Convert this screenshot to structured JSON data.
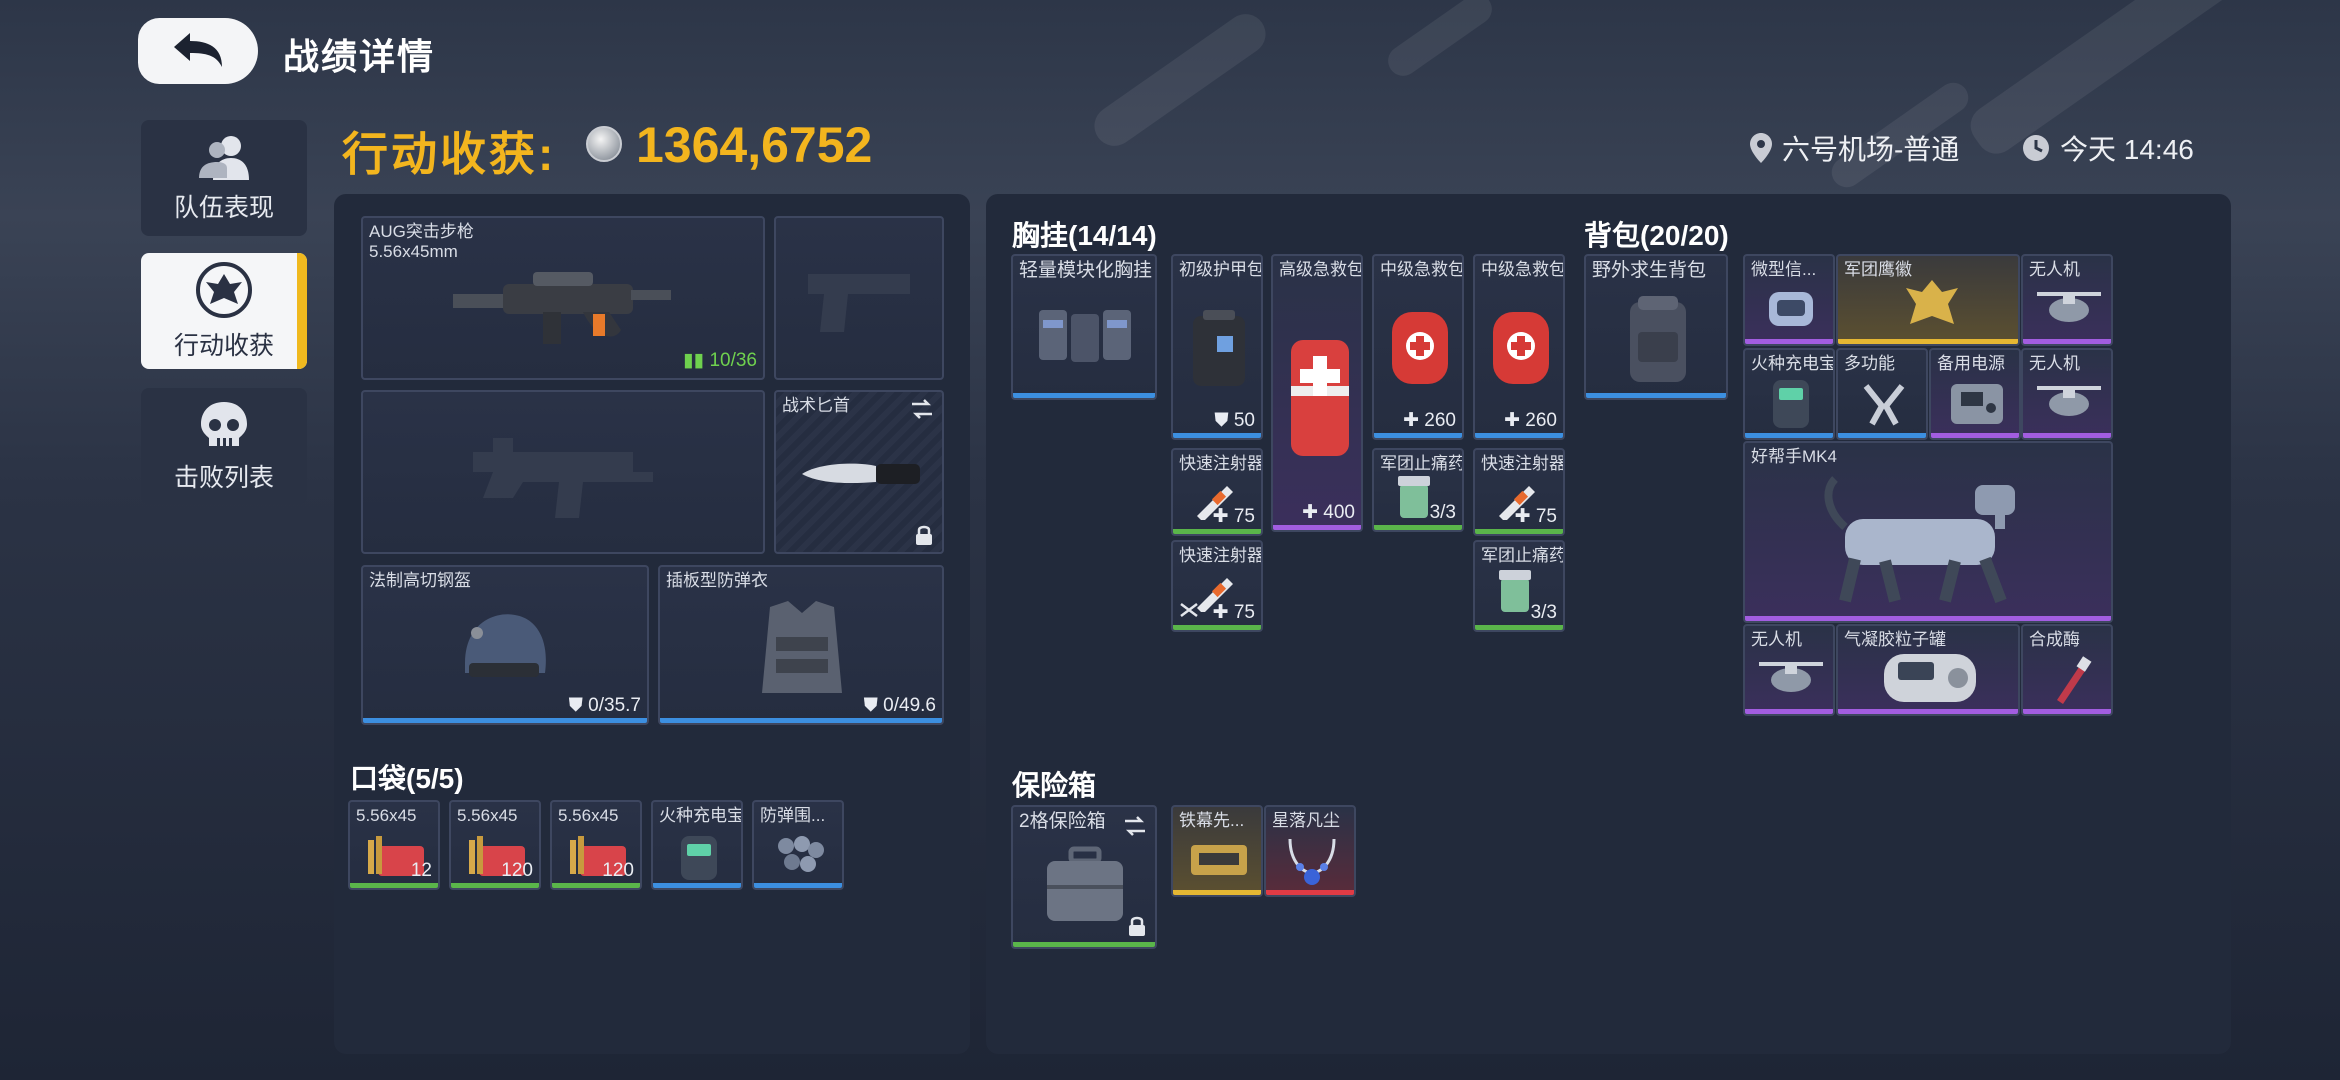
{
  "header": {
    "title": "战绩详情"
  },
  "tabs": [
    {
      "label": "队伍表现"
    },
    {
      "label": "行动收获"
    },
    {
      "label": "击败列表"
    }
  ],
  "harvest": {
    "label": "行动收获:",
    "value": "1364,6752"
  },
  "location": "六号机场-普通",
  "time": "今天 14:46",
  "equipment": {
    "primary": {
      "name": "AUG突击步枪",
      "ammo_type": "5.56x45mm",
      "ammo": "10/36"
    },
    "knife": {
      "name": "战术匕首"
    },
    "helmet": {
      "name": "法制高切钢盔",
      "durability": "0/35.7"
    },
    "armor": {
      "name": "插板型防弹衣",
      "durability": "0/49.6"
    }
  },
  "pockets": {
    "title": "口袋(5/5)",
    "items": [
      {
        "name": "5.56x45",
        "count": "12",
        "rarity": "green"
      },
      {
        "name": "5.56x45",
        "count": "120",
        "rarity": "green"
      },
      {
        "name": "5.56x45",
        "count": "120",
        "rarity": "green"
      },
      {
        "name": "火种充电宝",
        "count": "",
        "rarity": "blue"
      },
      {
        "name": "防弹围...",
        "count": "",
        "rarity": "blue"
      }
    ]
  },
  "chest_rig": {
    "title": "胸挂(14/14)",
    "container": "轻量模块化胸挂",
    "items": [
      {
        "name": "初级护甲包",
        "count": "50"
      },
      {
        "name": "高级急救包",
        "count": "400"
      },
      {
        "name": "中级急救包",
        "count": "260"
      },
      {
        "name": "中级急救包",
        "count": "260"
      },
      {
        "name": "快速注射器",
        "count": "75"
      },
      {
        "name": "军团止痛药",
        "count": "3/3"
      },
      {
        "name": "快速注射器",
        "count": "75"
      },
      {
        "name": "快速注射器",
        "count": "75"
      },
      {
        "name": "军团止痛药",
        "count": "3/3"
      }
    ]
  },
  "backpack": {
    "title": "背包(20/20)",
    "container": "野外求生背包",
    "items": [
      {
        "name": "微型信..."
      },
      {
        "name": "军团鹰徽"
      },
      {
        "name": "无人机"
      },
      {
        "name": "火种充电宝"
      },
      {
        "name": "多功能"
      },
      {
        "name": "备用电源"
      },
      {
        "name": "无人机"
      },
      {
        "name": "好帮手MK4"
      },
      {
        "name": "无人机"
      },
      {
        "name": "气凝胶粒子罐"
      },
      {
        "name": "合成酶"
      }
    ]
  },
  "safebox": {
    "title": "保险箱",
    "container": "2格保险箱",
    "items": [
      {
        "name": "铁幕先..."
      },
      {
        "name": "星落凡尘"
      }
    ]
  },
  "colors": {
    "accent": "#f3b51e",
    "blue": "#3c8fe0",
    "purple": "#a25de0",
    "green": "#5ab54a",
    "gold": "#e5b733",
    "red": "#e03b45"
  }
}
